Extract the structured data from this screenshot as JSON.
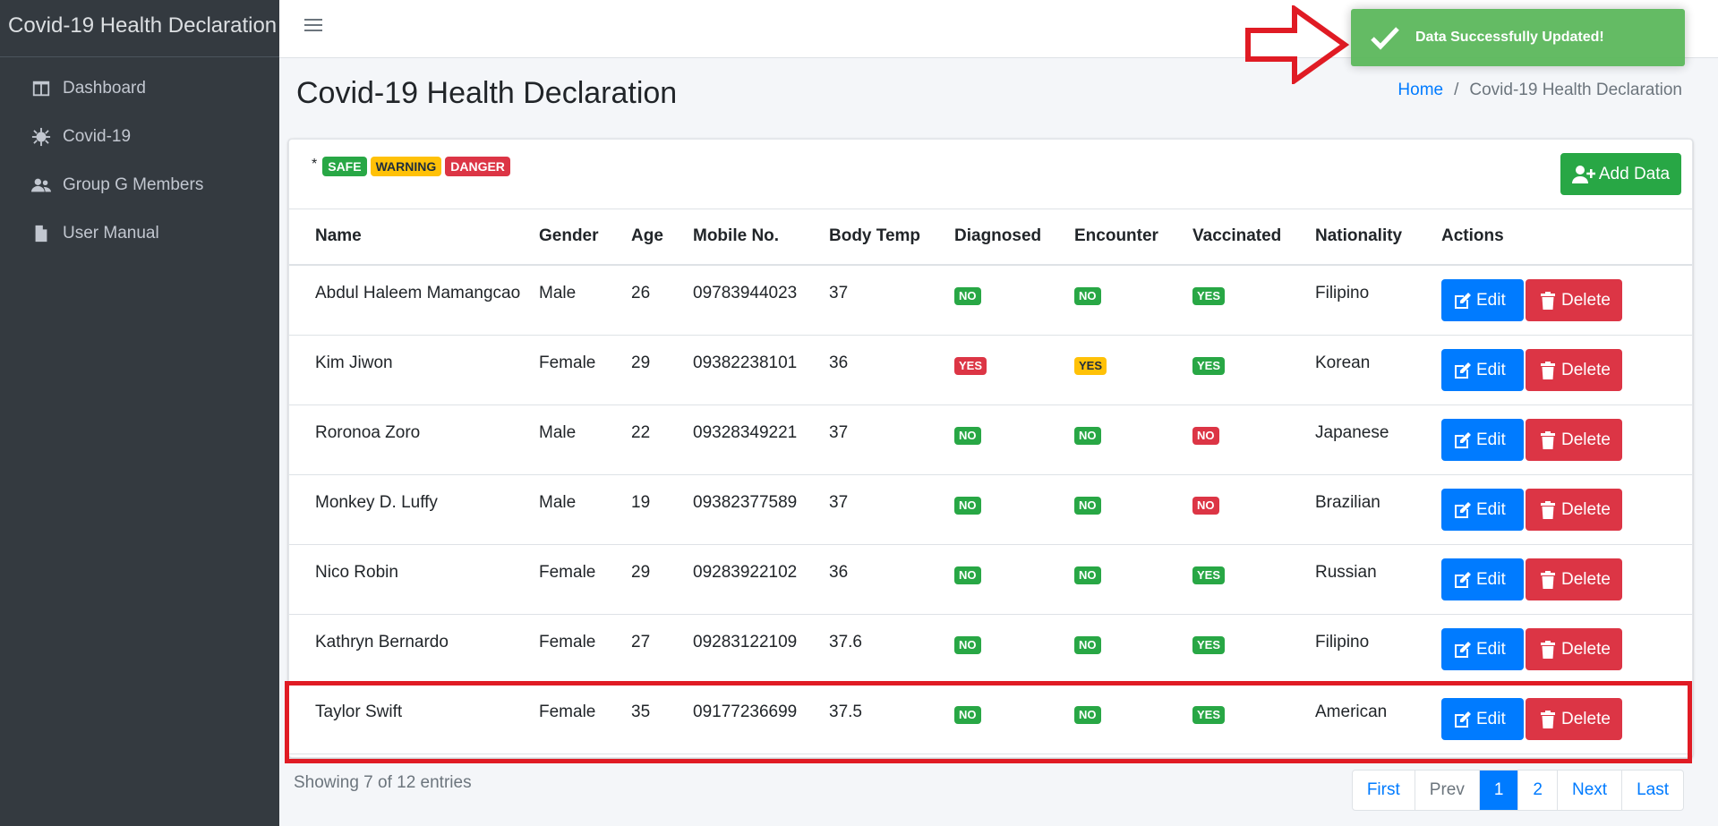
{
  "brand": "Covid-19 Health Declaration",
  "sidebar": {
    "items": [
      {
        "label": "Dashboard",
        "icon": "table-columns-icon"
      },
      {
        "label": "Covid-19",
        "icon": "virus-icon"
      },
      {
        "label": "Group G Members",
        "icon": "users-icon"
      },
      {
        "label": "User Manual",
        "icon": "file-icon"
      }
    ]
  },
  "header": {
    "title": "Covid-19 Health Declaration",
    "breadcrumb": {
      "home": "Home",
      "separator": "/",
      "current": "Covid-19 Health Declaration"
    }
  },
  "toast": {
    "message": "Data Successfully Updated!",
    "icon": "check-icon",
    "color": "#5cb85c"
  },
  "legend": {
    "star": "*",
    "safe": "SAFE",
    "warning": "WARNING",
    "danger": "DANGER"
  },
  "add_button": "Add Data",
  "table": {
    "headers": [
      "Name",
      "Gender",
      "Age",
      "Mobile No.",
      "Body Temp",
      "Diagnosed",
      "Encounter",
      "Vaccinated",
      "Nationality",
      "Actions"
    ],
    "rows": [
      {
        "name": "Abdul Haleem Mamangcao",
        "gender": "Male",
        "age": "26",
        "mobile": "09783944023",
        "temp": "37",
        "diagnosed": "NO",
        "encounter": "NO",
        "vaccinated": "YES",
        "nationality": "Filipino"
      },
      {
        "name": "Kim Jiwon",
        "gender": "Female",
        "age": "29",
        "mobile": "09382238101",
        "temp": "36",
        "diagnosed": "YES",
        "encounter": "YES",
        "vaccinated": "YES",
        "nationality": "Korean"
      },
      {
        "name": "Roronoa Zoro",
        "gender": "Male",
        "age": "22",
        "mobile": "09328349221",
        "temp": "37",
        "diagnosed": "NO",
        "encounter": "NO",
        "vaccinated": "NO",
        "nationality": "Japanese"
      },
      {
        "name": "Monkey D. Luffy",
        "gender": "Male",
        "age": "19",
        "mobile": "09382377589",
        "temp": "37",
        "diagnosed": "NO",
        "encounter": "NO",
        "vaccinated": "NO",
        "nationality": "Brazilian"
      },
      {
        "name": "Nico Robin",
        "gender": "Female",
        "age": "29",
        "mobile": "09283922102",
        "temp": "36",
        "diagnosed": "NO",
        "encounter": "NO",
        "vaccinated": "YES",
        "nationality": "Russian"
      },
      {
        "name": "Kathryn Bernardo",
        "gender": "Female",
        "age": "27",
        "mobile": "09283122109",
        "temp": "37.6",
        "diagnosed": "NO",
        "encounter": "NO",
        "vaccinated": "YES",
        "nationality": "Filipino"
      },
      {
        "name": "Taylor Swift",
        "gender": "Female",
        "age": "35",
        "mobile": "09177236699",
        "temp": "37.5",
        "diagnosed": "NO",
        "encounter": "NO",
        "vaccinated": "YES",
        "nationality": "American"
      }
    ],
    "edit_label": "Edit",
    "delete_label": "Delete"
  },
  "footer": {
    "info": "Showing 7 of 12 entries"
  },
  "pagination": {
    "first": "First",
    "prev": "Prev",
    "pages": [
      "1",
      "2"
    ],
    "next": "Next",
    "last": "Last",
    "active": "1"
  },
  "colors": {
    "sidebar": "#343a40",
    "safe": "#28a745",
    "warning": "#ffc107",
    "danger": "#dc3545",
    "primary": "#007bff",
    "highlight": "#e01b24"
  }
}
